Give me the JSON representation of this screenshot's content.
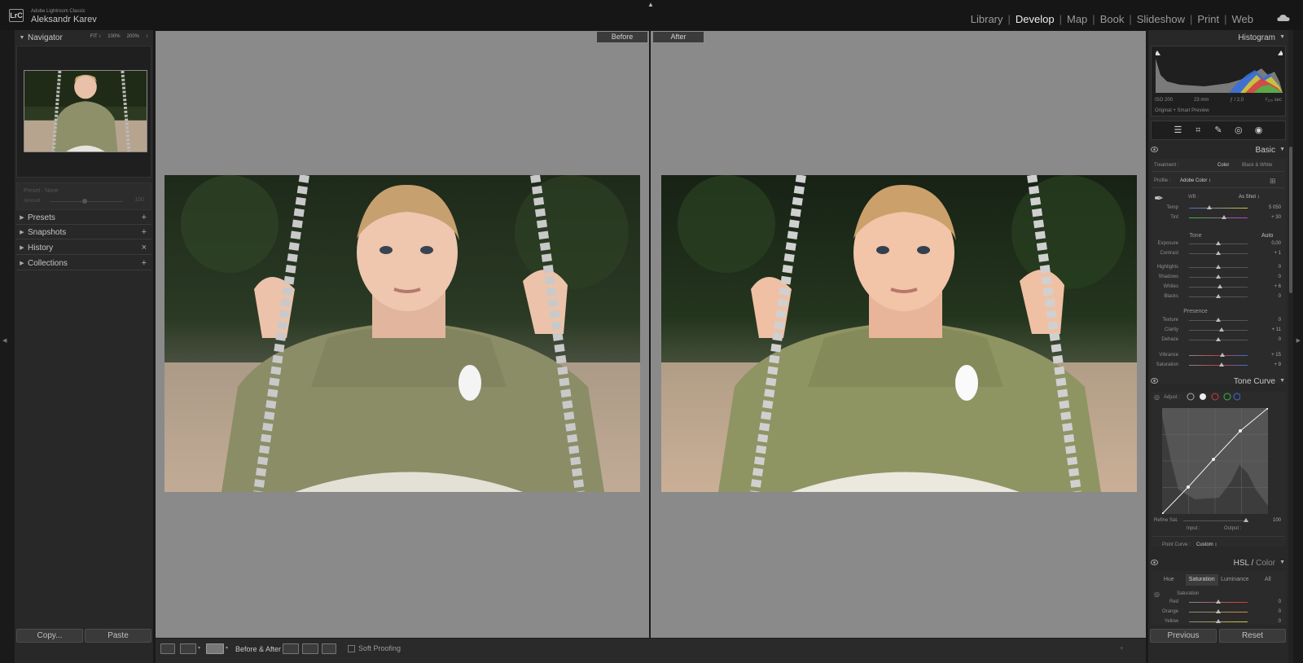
{
  "app": {
    "logo": "LrC",
    "name": "Adobe Lightroom Classic",
    "user": "Aleksandr Karev",
    "modules": [
      "Library",
      "Develop",
      "Map",
      "Book",
      "Slideshow",
      "Print",
      "Web"
    ],
    "active_module": "Develop"
  },
  "left_panel": {
    "navigator": {
      "title": "Navigator",
      "zoom_options": [
        "FIT ↕",
        "100%",
        "200%",
        "↕"
      ]
    },
    "preset_box": {
      "preset": "Preset : None",
      "amount_label": "Amount",
      "amount_value": "100"
    },
    "sections": [
      {
        "title": "Presets",
        "action": "+"
      },
      {
        "title": "Snapshots",
        "action": "+"
      },
      {
        "title": "History",
        "action": "×"
      },
      {
        "title": "Collections",
        "action": "+"
      }
    ],
    "copy_label": "Copy...",
    "paste_label": "Paste"
  },
  "center": {
    "before_label": "Before",
    "after_label": "After"
  },
  "toolbar": {
    "before_after_label": "Before & After :",
    "soft_proofing_label": "Soft Proofing"
  },
  "right_panel": {
    "histogram": {
      "title": "Histogram",
      "iso": "ISO 200",
      "focal": "23 mm",
      "aperture": "ƒ / 2,0",
      "shutter": "¹⁄₁₂₅ sec",
      "preview": "Original + Smart Preview"
    },
    "basic": {
      "title": "Basic",
      "treatment_label": "Treatment :",
      "treatment_color": "Color",
      "treatment_bw": "Black & White",
      "profile_label": "Profile :",
      "profile_value": "Adobe Color ↕",
      "wb_label": "WB :",
      "wb_value": "As Shot ↕",
      "tone_label": "Tone",
      "auto_label": "Auto",
      "presence_label": "Presence",
      "sliders": [
        {
          "label": "Temp",
          "value": "5 050",
          "pos": 0.35
        },
        {
          "label": "Tint",
          "value": "+ 30",
          "pos": 0.6
        },
        {
          "label": "Exposure",
          "value": "0,00",
          "pos": 0.5
        },
        {
          "label": "Contrast",
          "value": "+ 1",
          "pos": 0.5
        },
        {
          "label": "Highlights",
          "value": "0",
          "pos": 0.5
        },
        {
          "label": "Shadows",
          "value": "0",
          "pos": 0.5
        },
        {
          "label": "Whites",
          "value": "+ 6",
          "pos": 0.53
        },
        {
          "label": "Blacks",
          "value": "0",
          "pos": 0.5
        },
        {
          "label": "Texture",
          "value": "0",
          "pos": 0.5
        },
        {
          "label": "Clarity",
          "value": "+ 11",
          "pos": 0.55
        },
        {
          "label": "Dehaze",
          "value": "0",
          "pos": 0.5
        },
        {
          "label": "Vibrance",
          "value": "+ 15",
          "pos": 0.57
        },
        {
          "label": "Saturation",
          "value": "+ 9",
          "pos": 0.55
        }
      ]
    },
    "tone_curve": {
      "title": "Tone Curve",
      "adjust_label": "Adjust :",
      "refine_label": "Refine Sat.",
      "refine_value": "100",
      "input_label": "Input :",
      "output_label": "Output :",
      "point_curve_label": "Point Curve :",
      "point_curve_value": "Custom ↕"
    },
    "hsl": {
      "title_hsl": "HSL",
      "title_color": "Color",
      "tabs": [
        "Hue",
        "Saturation",
        "Luminance",
        "All"
      ],
      "active_tab": "Saturation",
      "section_label": "Saturation",
      "rows": [
        {
          "label": "Red",
          "value": "0"
        },
        {
          "label": "Orange",
          "value": "0"
        },
        {
          "label": "Yellow",
          "value": "0"
        }
      ]
    },
    "previous_label": "Previous",
    "reset_label": "Reset"
  }
}
